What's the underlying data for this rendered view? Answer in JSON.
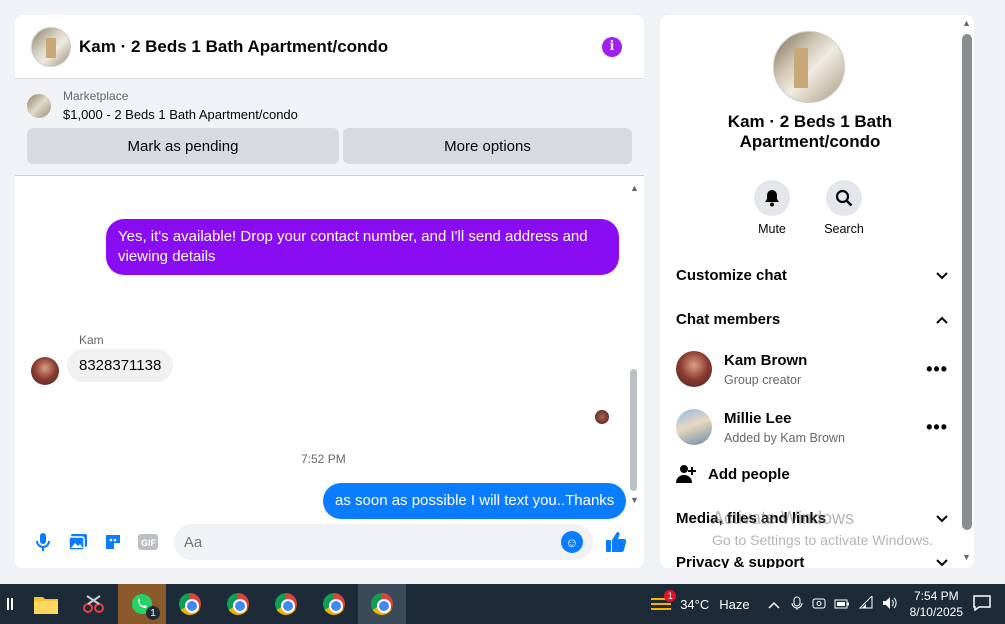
{
  "chat": {
    "title": "Kam · 2 Beds 1 Bath Apartment/condo",
    "marketplace_label": "Marketplace",
    "listing": "$1,000 - 2 Beds 1 Bath Apartment/condo",
    "mark_pending": "Mark as pending",
    "more_options": "More options",
    "messages": {
      "out1": "Yes, it's available! Drop your contact number, and I'll send address and viewing details",
      "sender": "Kam",
      "in1": "8328371138",
      "time": "7:52 PM",
      "out2": "as soon as possible I will text you..Thanks"
    },
    "input_placeholder": "Aa"
  },
  "info": {
    "title": "Kam · 2 Beds 1 Bath Apartment/condo",
    "mute": "Mute",
    "search": "Search",
    "customize": "Customize chat",
    "members_header": "Chat members",
    "members": [
      {
        "name": "Kam Brown",
        "sub": "Group creator"
      },
      {
        "name": "Millie Lee",
        "sub": "Added by Kam Brown"
      }
    ],
    "add_people": "Add people",
    "media": "Media, files and links",
    "privacy": "Privacy & support",
    "watermark1": "Activate Windows",
    "watermark2": "Go to Settings to activate Windows."
  },
  "taskbar": {
    "wa_badge": "1",
    "weather_temp": "34°C",
    "weather_desc": "Haze",
    "weather_badge": "1",
    "time": "7:54 PM",
    "date": "8/10/2025"
  }
}
